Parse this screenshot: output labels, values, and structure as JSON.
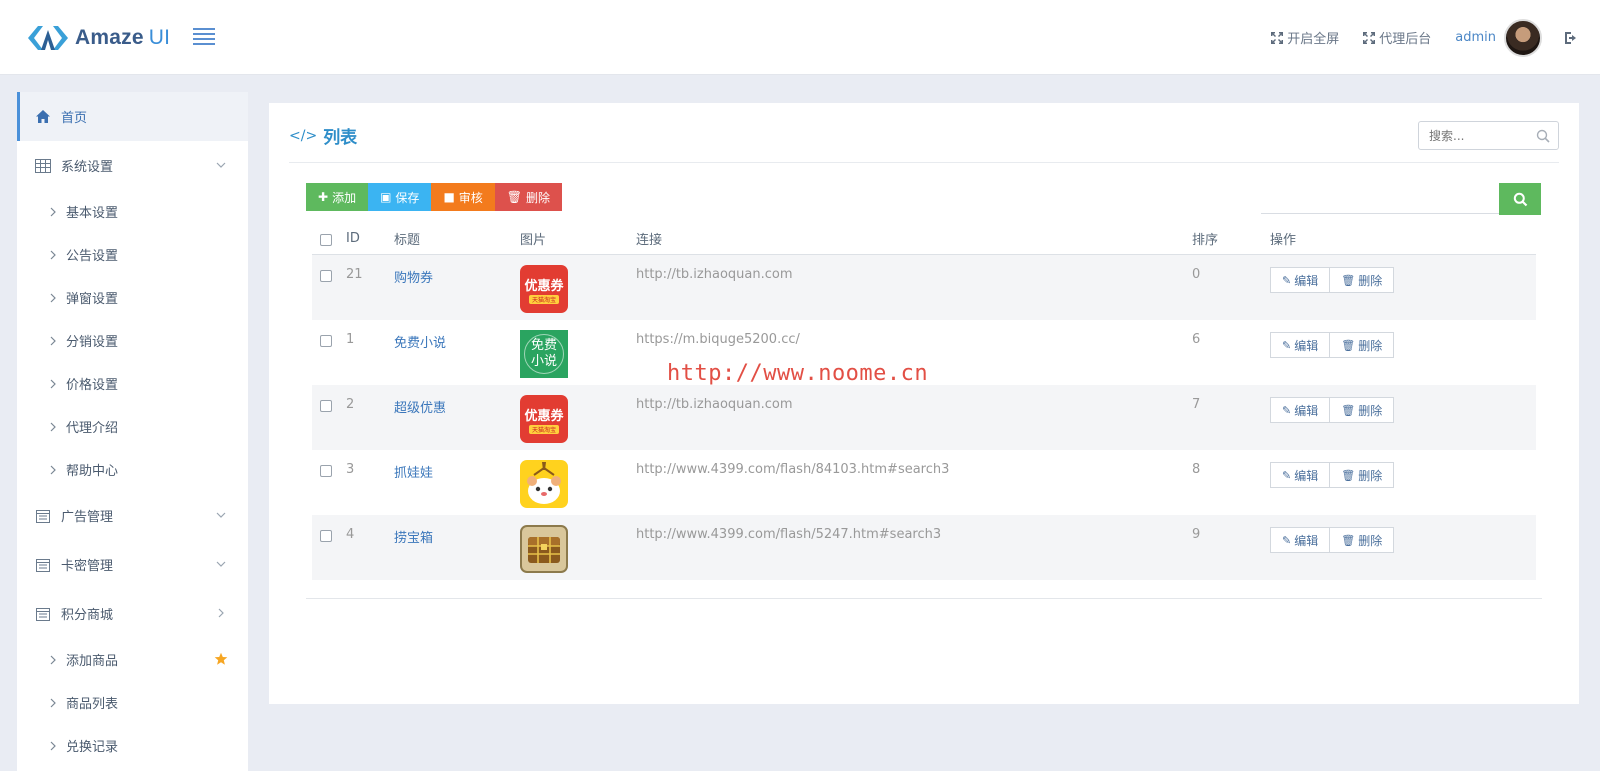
{
  "header": {
    "logo_main": "Amaze",
    "logo_ui": "UI",
    "fullscreen_label": "开启全屏",
    "agent_backend_label": "代理后台",
    "admin_name": "admin"
  },
  "sidebar": {
    "home": "首页",
    "system_settings": "系统设置",
    "system_sub": [
      "基本设置",
      "公告设置",
      "弹窗设置",
      "分销设置",
      "价格设置",
      "代理介绍",
      "帮助中心"
    ],
    "ad_management": "广告管理",
    "card_management": "卡密管理",
    "points_mall": "积分商城",
    "mall_sub": [
      "添加商品",
      "商品列表",
      "兑换记录"
    ]
  },
  "panel": {
    "title": "列表",
    "search_placeholder": "搜索..."
  },
  "toolbar": {
    "add": "添加",
    "save": "保存",
    "audit": "审核",
    "delete": "删除"
  },
  "table": {
    "headers": {
      "id": "ID",
      "title": "标题",
      "image": "图片",
      "link": "连接",
      "sort": "排序",
      "ops": "操作"
    },
    "edit_label": "编辑",
    "delete_label": "删除",
    "coupon_text": "优惠券",
    "coupon_sub": "天猫淘宝",
    "novel_text_1": "免费",
    "novel_text_2": "小说",
    "rows": [
      {
        "id": "21",
        "title": "购物券",
        "link": "http://tb.izhaoquan.com",
        "sort": "0"
      },
      {
        "id": "1",
        "title": "免费小说",
        "link": "https://m.biquge5200.cc/",
        "sort": "6"
      },
      {
        "id": "2",
        "title": "超级优惠",
        "link": "http://tb.izhaoquan.com",
        "sort": "7"
      },
      {
        "id": "3",
        "title": "抓娃娃",
        "link": "http://www.4399.com/flash/84103.htm#search3",
        "sort": "8"
      },
      {
        "id": "4",
        "title": "捞宝箱",
        "link": "http://www.4399.com/flash/5247.htm#search3",
        "sort": "9"
      }
    ]
  },
  "watermark": "http://www.noome.cn",
  "colors": {
    "accent": "#2e8ec9",
    "success": "#5eb95e",
    "secondary": "#3bb4f2",
    "warning": "#f37b1d",
    "danger": "#dd514c"
  }
}
